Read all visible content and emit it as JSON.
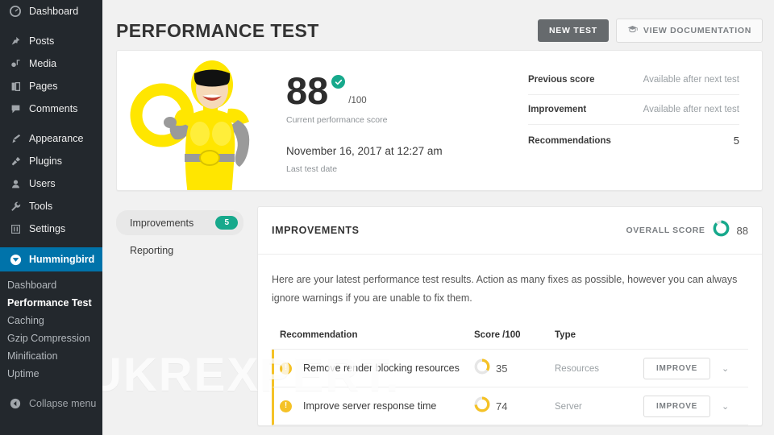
{
  "sidebar": {
    "items": [
      {
        "label": "Dashboard",
        "icon": "dashboard-icon"
      },
      {
        "label": "Posts",
        "icon": "pin-icon"
      },
      {
        "label": "Media",
        "icon": "media-icon"
      },
      {
        "label": "Pages",
        "icon": "pages-icon"
      },
      {
        "label": "Comments",
        "icon": "comments-icon"
      },
      {
        "label": "Appearance",
        "icon": "brush-icon"
      },
      {
        "label": "Plugins",
        "icon": "plug-icon"
      },
      {
        "label": "Users",
        "icon": "users-icon"
      },
      {
        "label": "Tools",
        "icon": "wrench-icon"
      },
      {
        "label": "Settings",
        "icon": "sliders-icon"
      }
    ],
    "hummingbird": {
      "label": "Hummingbird",
      "icon": "hummingbird-icon"
    },
    "submenu": [
      {
        "label": "Dashboard",
        "current": false
      },
      {
        "label": "Performance Test",
        "current": true
      },
      {
        "label": "Caching",
        "current": false
      },
      {
        "label": "Gzip Compression",
        "current": false
      },
      {
        "label": "Minification",
        "current": false
      },
      {
        "label": "Uptime",
        "current": false
      }
    ],
    "collapse_label": "Collapse menu",
    "collapse_icon": "chevron-left-circle-icon"
  },
  "watermark": "UKREXPERT.",
  "header": {
    "title": "PERFORMANCE TEST",
    "new_test_label": "NEW TEST",
    "view_docs_label": "VIEW DOCUMENTATION",
    "view_docs_icon": "graduation-cap-icon"
  },
  "summary": {
    "hero_icon": "superhero-mascot-illustration",
    "score": "88",
    "score_badge_icon": "check-circle-icon",
    "score_denominator": "/100",
    "score_caption": "Current performance score",
    "test_date": "November 16, 2017 at 12:27 am",
    "test_date_caption": "Last test date",
    "stats": [
      {
        "label": "Previous score",
        "value": "Available after next test",
        "emphasis": false
      },
      {
        "label": "Improvement",
        "value": "Available after next test",
        "emphasis": false
      },
      {
        "label": "Recommendations",
        "value": "5",
        "emphasis": true
      }
    ]
  },
  "tabs": [
    {
      "label": "Improvements",
      "badge": "5",
      "active": true
    },
    {
      "label": "Reporting",
      "badge": "",
      "active": false
    }
  ],
  "panel": {
    "title": "IMPROVEMENTS",
    "overall_label": "OVERALL SCORE",
    "overall_value": "88",
    "overall_percent": 88,
    "intro": "Here are your latest performance test results. Action as many fixes as possible, however you can always ignore warnings if you are unable to fix them.",
    "columns": {
      "recommendation": "Recommendation",
      "score": "Score /100",
      "type": "Type"
    },
    "rows": [
      {
        "warning_icon": "warning-icon",
        "name": "Remove render blocking resources",
        "score": "35",
        "score_percent": 35,
        "type": "Resources",
        "action_label": "IMPROVE",
        "expand_icon": "chevron-down-icon"
      },
      {
        "warning_icon": "warning-icon",
        "name": "Improve server response time",
        "score": "74",
        "score_percent": 74,
        "type": "Server",
        "action_label": "IMPROVE",
        "expand_icon": "chevron-down-icon"
      }
    ]
  },
  "colors": {
    "wp_sidebar": "#23282d",
    "wp_blue": "#0073aa",
    "teal": "#17a98c",
    "amber": "#f5c227",
    "page_bg": "#f1f1f1"
  }
}
